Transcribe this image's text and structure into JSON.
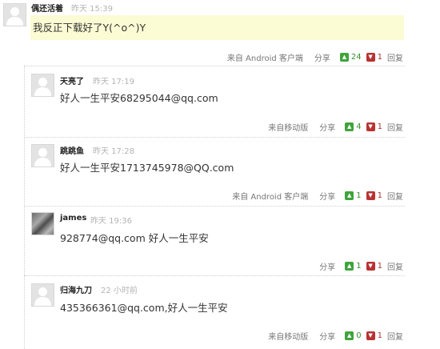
{
  "labels": {
    "share": "分享",
    "reply": "回复"
  },
  "main": {
    "name": "偶还活着",
    "time": "昨天 15:39",
    "text": "我反正下载好了Y(^o^)Y",
    "source": "来自 Android 客户端",
    "up": "24",
    "down": "1"
  },
  "replies": [
    {
      "name": "天亮了",
      "time": "昨天 17:19",
      "text": "好人一生平安68295044@qq.com",
      "source": "来自移动版",
      "up": "4",
      "down": "1"
    },
    {
      "name": "跳跳鱼",
      "time": "昨天 17:28",
      "text": "好人一生平安1713745978@QQ.com",
      "source": "来自 Android 客户端",
      "up": "1",
      "down": "1"
    },
    {
      "name": "james",
      "time": "昨天 19:36",
      "text": "928774@qq.com 好人一生平安",
      "source": "",
      "up": "1",
      "down": "1"
    },
    {
      "name": "归海九刀",
      "time": "22 小时前",
      "text": "435366361@qq.com,好人一生平安",
      "source": "来自移动版",
      "up": "0",
      "down": "1"
    }
  ]
}
